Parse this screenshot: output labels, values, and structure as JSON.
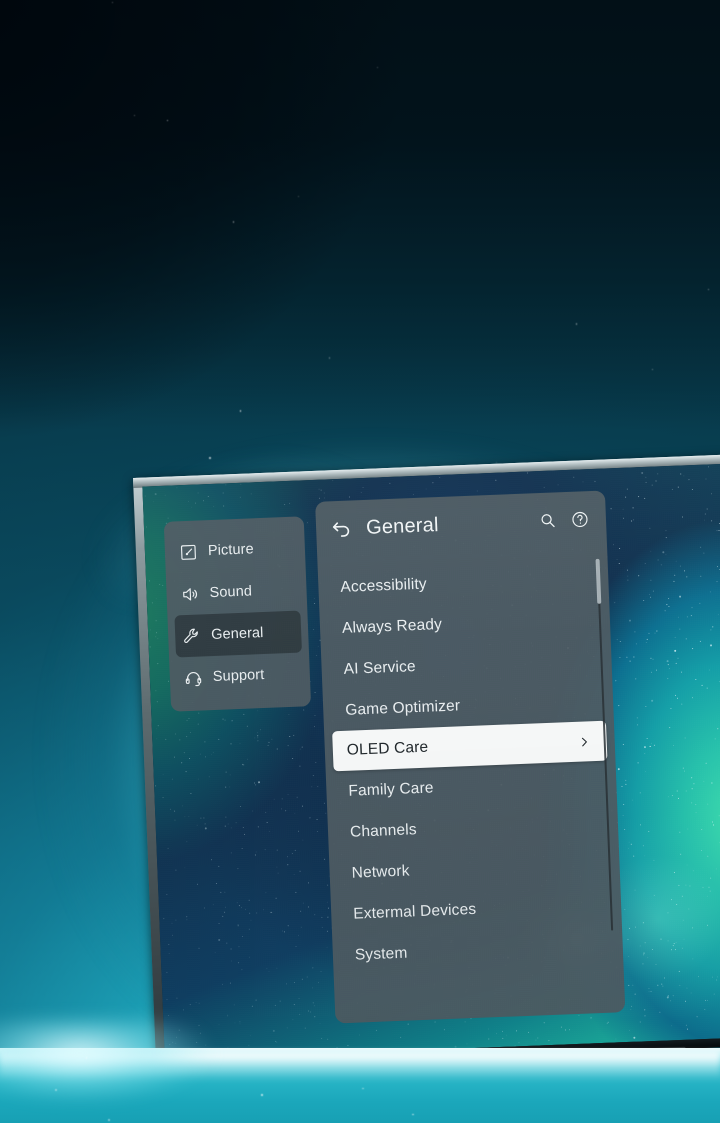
{
  "device": {
    "type": "oled-television",
    "wallpaper": "starfield-teal-blue-gradient"
  },
  "colors": {
    "panel_bg": "#4e5b63",
    "panel_selected_bg": "#2f393f",
    "highlight_bg": "#f7f9f9",
    "highlight_text": "#20272b",
    "text": "#e9eef0",
    "accent_glow": "#7ee2ec",
    "room_bg_top": "#02131a",
    "floor": "#1ba7bb"
  },
  "sidebar": {
    "items": [
      {
        "label": "Picture",
        "icon": "picture-icon",
        "selected": false
      },
      {
        "label": "Sound",
        "icon": "speaker-icon",
        "selected": false
      },
      {
        "label": "General",
        "icon": "wrench-icon",
        "selected": true
      },
      {
        "label": "Support",
        "icon": "headset-icon",
        "selected": false
      }
    ]
  },
  "main": {
    "header": {
      "back_icon": "back-arrow-icon",
      "title": "General",
      "actions": [
        {
          "name": "search-icon",
          "label": "Search"
        },
        {
          "name": "help-icon",
          "label": "Help"
        }
      ]
    },
    "menu": [
      {
        "label": "Accessibility",
        "active": false,
        "has_chevron": false
      },
      {
        "label": "Always Ready",
        "active": false,
        "has_chevron": false
      },
      {
        "label": "AI Service",
        "active": false,
        "has_chevron": false
      },
      {
        "label": "Game Optimizer",
        "active": false,
        "has_chevron": false
      },
      {
        "label": "OLED Care",
        "active": true,
        "has_chevron": true
      },
      {
        "label": "Family Care",
        "active": false,
        "has_chevron": false
      },
      {
        "label": "Channels",
        "active": false,
        "has_chevron": false
      },
      {
        "label": "Network",
        "active": false,
        "has_chevron": false
      },
      {
        "label": "Extermal Devices",
        "active": false,
        "has_chevron": false
      },
      {
        "label": "System",
        "active": false,
        "has_chevron": false
      }
    ],
    "scrollbar": {
      "visible": true,
      "thumb_position": "top"
    }
  }
}
